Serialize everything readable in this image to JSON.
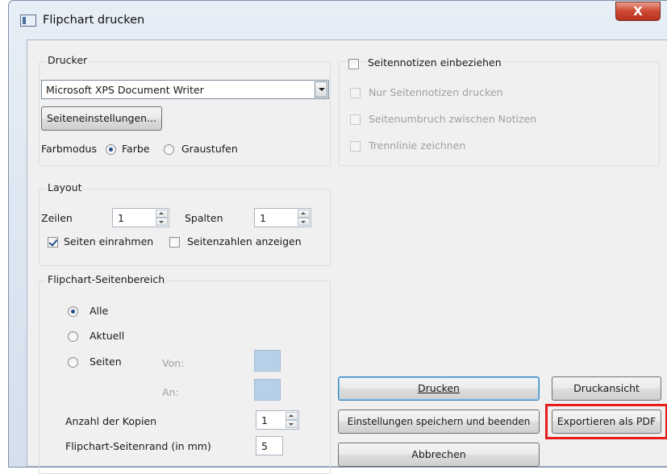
{
  "window": {
    "title": "Flipchart drucken",
    "close_glyph": "X",
    "icon": "app-window-icon"
  },
  "printer": {
    "group_label": "Drucker",
    "selected": "Microsoft XPS Document Writer",
    "page_setup_label": "Seiteneinstellungen...",
    "color_mode_label": "Farbmodus",
    "color_label": "Farbe",
    "grayscale_label": "Graustufen",
    "color_selected": "Farbe"
  },
  "layout": {
    "group_label": "Layout",
    "rows_label": "Zeilen",
    "rows_value": "1",
    "cols_label": "Spalten",
    "cols_value": "1",
    "frame_pages_label": "Seiten einrahmen",
    "frame_pages_checked": true,
    "show_page_numbers_label": "Seitenzahlen anzeigen",
    "show_page_numbers_checked": false
  },
  "range": {
    "group_label": "Flipchart-Seitenbereich",
    "all_label": "Alle",
    "current_label": "Aktuell",
    "pages_label": "Seiten",
    "from_label": "Von:",
    "to_label": "An:",
    "selected": "Alle",
    "copies_label": "Anzahl der Kopien",
    "copies_value": "1",
    "margin_label": "Flipchart-Seitenrand (in mm)",
    "margin_value": "5"
  },
  "notes": {
    "include_label": "Seitennotizen einbeziehen",
    "include_checked": false,
    "only_notes_label": "Nur Seitennotizen drucken",
    "page_break_label": "Seitenumbruch zwischen Notizen",
    "divider_label": "Trennlinie zeichnen"
  },
  "buttons": {
    "print_label": "Drucken",
    "preview_label": "Druckansicht",
    "save_close_label": "Einstellungen speichern und beenden",
    "export_pdf_label": "Exportieren als PDF",
    "cancel_label": "Abbrechen"
  },
  "colors": {
    "highlight": "#e51d1d",
    "default_button_border": "#3c7fb1"
  }
}
